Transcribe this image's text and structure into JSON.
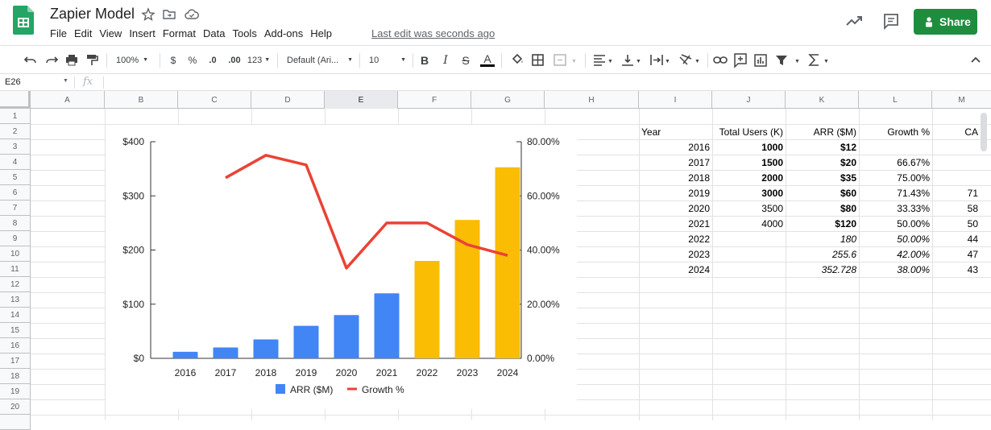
{
  "app": {
    "title": "Zapier Model",
    "last_edit": "Last edit was seconds ago",
    "share_label": "Share",
    "menu": [
      "File",
      "Edit",
      "View",
      "Insert",
      "Format",
      "Data",
      "Tools",
      "Add-ons",
      "Help"
    ],
    "accent_color": "#1e8e3e"
  },
  "toolbar": {
    "zoom": "100%",
    "currency": "$",
    "percent": "%",
    "decrease_decimals": ".0",
    "increase_decimals": ".00",
    "more_formats": "123",
    "font": "Default (Ari...",
    "font_size": "10",
    "bold": "B",
    "italic": "I",
    "strike": "S",
    "text_color": "A"
  },
  "formula_bar": {
    "name_box": "E26",
    "fx": "fx",
    "value": ""
  },
  "grid": {
    "columns": [
      "A",
      "B",
      "C",
      "D",
      "E",
      "F",
      "G",
      "H",
      "I",
      "J",
      "K",
      "L",
      "M"
    ],
    "active_column": "E",
    "rows": [
      "1",
      "2",
      "3",
      "4",
      "5",
      "6",
      "7",
      "8",
      "9",
      "10",
      "11",
      "12",
      "13",
      "14",
      "15",
      "16",
      "17",
      "18",
      "19",
      "20"
    ]
  },
  "table": {
    "headers": [
      "Year",
      "Total Users (K)",
      "ARR ($M)",
      "Growth %",
      "CA"
    ],
    "rows": [
      {
        "year": "2016",
        "users": "1000",
        "arr": "$12",
        "growth": "",
        "ca": ""
      },
      {
        "year": "2017",
        "users": "1500",
        "arr": "$20",
        "growth": "66.67%",
        "ca": ""
      },
      {
        "year": "2018",
        "users": "2000",
        "arr": "$35",
        "growth": "75.00%",
        "ca": ""
      },
      {
        "year": "2019",
        "users": "3000",
        "arr": "$60",
        "growth": "71.43%",
        "ca": "71"
      },
      {
        "year": "2020",
        "users": "3500",
        "arr": "$80",
        "growth": "33.33%",
        "ca": "58"
      },
      {
        "year": "2021",
        "users": "4000",
        "arr": "$120",
        "growth": "50.00%",
        "ca": "50"
      },
      {
        "year": "2022",
        "users": "",
        "arr": "180",
        "growth": "50.00%",
        "ca": "44"
      },
      {
        "year": "2023",
        "users": "",
        "arr": "255.6",
        "growth": "42.00%",
        "ca": "47"
      },
      {
        "year": "2024",
        "users": "",
        "arr": "352.728",
        "growth": "38.00%",
        "ca": "43"
      }
    ]
  },
  "chart_data": {
    "type": "bar",
    "categories": [
      "2016",
      "2017",
      "2018",
      "2019",
      "2020",
      "2021",
      "2022",
      "2023",
      "2024"
    ],
    "series": [
      {
        "name": "ARR ($M)",
        "type": "bar",
        "values": [
          12,
          20,
          35,
          60,
          80,
          120,
          180,
          255.6,
          352.728
        ],
        "colors": [
          "#4285f4",
          "#4285f4",
          "#4285f4",
          "#4285f4",
          "#4285f4",
          "#4285f4",
          "#fbbc04",
          "#fbbc04",
          "#fbbc04"
        ]
      },
      {
        "name": "Growth %",
        "type": "line",
        "axis": "right",
        "values": [
          null,
          66.67,
          75.0,
          71.43,
          33.33,
          50.0,
          50.0,
          42.0,
          38.0
        ],
        "color": "#ea4335"
      }
    ],
    "left_axis": {
      "ticks": [
        "$0",
        "$100",
        "$200",
        "$300",
        "$400"
      ],
      "ylim": [
        0,
        400
      ]
    },
    "right_axis": {
      "ticks": [
        "0.00%",
        "20.00%",
        "40.00%",
        "60.00%",
        "80.00%"
      ],
      "ylim": [
        0,
        80
      ]
    },
    "legend": "bottom",
    "grid": false
  }
}
